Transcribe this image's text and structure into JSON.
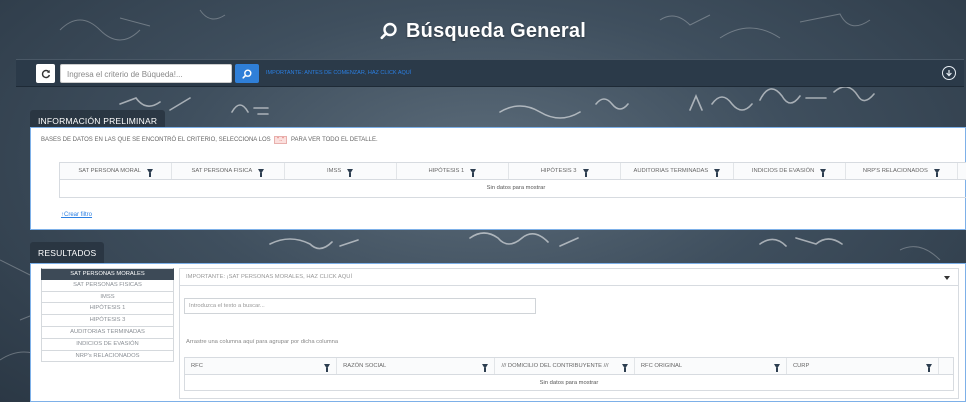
{
  "header": {
    "title": "Búsqueda General"
  },
  "search": {
    "placeholder": "Ingresa el criterio de Búqueda!...",
    "important_link": "IMPORTANTE: ANTES DE COMENZAR, HAZ CLICK AQUÍ"
  },
  "preliminary": {
    "section_title": "INFORMACIÓN PRELIMINAR",
    "note_before": "BASES DE DATOS EN LAS QUE SE ENCONTRÓ EL CRITERIO, SELECCIONA LOS",
    "note_badge": "\"..\"",
    "note_after": "PARA VER TODO EL DETALLE.",
    "columns": [
      "SAT PERSONA MORAL",
      "SAT PERSONA FISICA",
      "IMSS",
      "HIPÓTESIS 1",
      "HIPÓTESIS 3",
      "AUDITORIAS TERMINADAS",
      "INDICIOS DE EVASIÓN",
      "NRP'S RELACIONADOS"
    ],
    "empty_text": "Sin datos para mostrar",
    "create_filter": "Crear filtro"
  },
  "results": {
    "section_title": "RESULTADOS",
    "tabs": [
      "SAT PERSONAS MORALES",
      "SAT PERSONAS FISICAS",
      "IMSS",
      "HIPÓTESIS 1",
      "HIPÓTESIS 3",
      "AUDITORIAS TERMINADAS",
      "INDICIOS DE EVASIÓN",
      "NRP's RELACIONADOS"
    ],
    "active_tab": "SAT PERSONAS MORALES",
    "dropdown_text": "IMPORTANTE: ¡SAT PERSONAS MORALES, HAZ CLICK AQUÍ",
    "filter_placeholder": "Introduzca el texto a buscar...",
    "group_hint": "Arrastre una columna aquí para agrupar por dicha columna",
    "columns": [
      "RFC",
      "RAZÓN SOCIAL",
      "/// DOMICILIO DEL CONTRIBUYENTE ///",
      "RFC ORIGINAL",
      "CURP"
    ],
    "empty_text": "Sin datos para mostrar"
  },
  "colors": {
    "accent": "#2f7fd8",
    "active_tab": "#3d4a57",
    "panel_border": "#7db0e8"
  }
}
